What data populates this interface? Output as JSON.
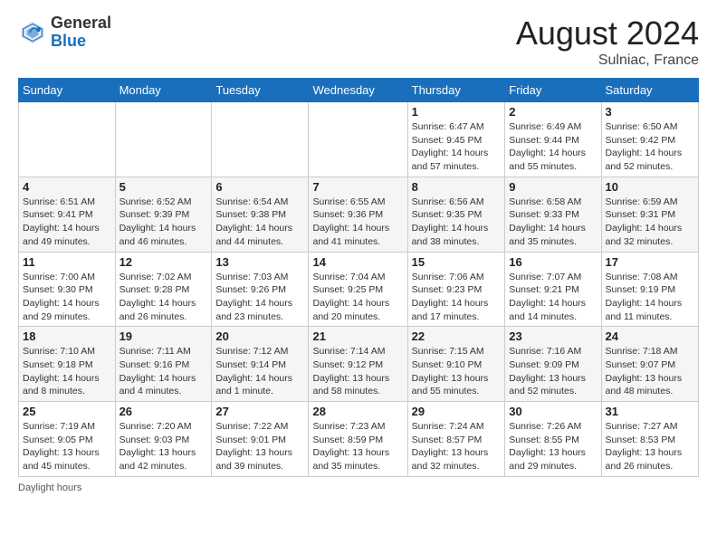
{
  "header": {
    "logo_general": "General",
    "logo_blue": "Blue",
    "month_year": "August 2024",
    "location": "Sulniac, France"
  },
  "days_of_week": [
    "Sunday",
    "Monday",
    "Tuesday",
    "Wednesday",
    "Thursday",
    "Friday",
    "Saturday"
  ],
  "weeks": [
    [
      {
        "day": "",
        "info": ""
      },
      {
        "day": "",
        "info": ""
      },
      {
        "day": "",
        "info": ""
      },
      {
        "day": "",
        "info": ""
      },
      {
        "day": "1",
        "info": "Sunrise: 6:47 AM\nSunset: 9:45 PM\nDaylight: 14 hours and 57 minutes."
      },
      {
        "day": "2",
        "info": "Sunrise: 6:49 AM\nSunset: 9:44 PM\nDaylight: 14 hours and 55 minutes."
      },
      {
        "day": "3",
        "info": "Sunrise: 6:50 AM\nSunset: 9:42 PM\nDaylight: 14 hours and 52 minutes."
      }
    ],
    [
      {
        "day": "4",
        "info": "Sunrise: 6:51 AM\nSunset: 9:41 PM\nDaylight: 14 hours and 49 minutes."
      },
      {
        "day": "5",
        "info": "Sunrise: 6:52 AM\nSunset: 9:39 PM\nDaylight: 14 hours and 46 minutes."
      },
      {
        "day": "6",
        "info": "Sunrise: 6:54 AM\nSunset: 9:38 PM\nDaylight: 14 hours and 44 minutes."
      },
      {
        "day": "7",
        "info": "Sunrise: 6:55 AM\nSunset: 9:36 PM\nDaylight: 14 hours and 41 minutes."
      },
      {
        "day": "8",
        "info": "Sunrise: 6:56 AM\nSunset: 9:35 PM\nDaylight: 14 hours and 38 minutes."
      },
      {
        "day": "9",
        "info": "Sunrise: 6:58 AM\nSunset: 9:33 PM\nDaylight: 14 hours and 35 minutes."
      },
      {
        "day": "10",
        "info": "Sunrise: 6:59 AM\nSunset: 9:31 PM\nDaylight: 14 hours and 32 minutes."
      }
    ],
    [
      {
        "day": "11",
        "info": "Sunrise: 7:00 AM\nSunset: 9:30 PM\nDaylight: 14 hours and 29 minutes."
      },
      {
        "day": "12",
        "info": "Sunrise: 7:02 AM\nSunset: 9:28 PM\nDaylight: 14 hours and 26 minutes."
      },
      {
        "day": "13",
        "info": "Sunrise: 7:03 AM\nSunset: 9:26 PM\nDaylight: 14 hours and 23 minutes."
      },
      {
        "day": "14",
        "info": "Sunrise: 7:04 AM\nSunset: 9:25 PM\nDaylight: 14 hours and 20 minutes."
      },
      {
        "day": "15",
        "info": "Sunrise: 7:06 AM\nSunset: 9:23 PM\nDaylight: 14 hours and 17 minutes."
      },
      {
        "day": "16",
        "info": "Sunrise: 7:07 AM\nSunset: 9:21 PM\nDaylight: 14 hours and 14 minutes."
      },
      {
        "day": "17",
        "info": "Sunrise: 7:08 AM\nSunset: 9:19 PM\nDaylight: 14 hours and 11 minutes."
      }
    ],
    [
      {
        "day": "18",
        "info": "Sunrise: 7:10 AM\nSunset: 9:18 PM\nDaylight: 14 hours and 8 minutes."
      },
      {
        "day": "19",
        "info": "Sunrise: 7:11 AM\nSunset: 9:16 PM\nDaylight: 14 hours and 4 minutes."
      },
      {
        "day": "20",
        "info": "Sunrise: 7:12 AM\nSunset: 9:14 PM\nDaylight: 14 hours and 1 minute."
      },
      {
        "day": "21",
        "info": "Sunrise: 7:14 AM\nSunset: 9:12 PM\nDaylight: 13 hours and 58 minutes."
      },
      {
        "day": "22",
        "info": "Sunrise: 7:15 AM\nSunset: 9:10 PM\nDaylight: 13 hours and 55 minutes."
      },
      {
        "day": "23",
        "info": "Sunrise: 7:16 AM\nSunset: 9:09 PM\nDaylight: 13 hours and 52 minutes."
      },
      {
        "day": "24",
        "info": "Sunrise: 7:18 AM\nSunset: 9:07 PM\nDaylight: 13 hours and 48 minutes."
      }
    ],
    [
      {
        "day": "25",
        "info": "Sunrise: 7:19 AM\nSunset: 9:05 PM\nDaylight: 13 hours and 45 minutes."
      },
      {
        "day": "26",
        "info": "Sunrise: 7:20 AM\nSunset: 9:03 PM\nDaylight: 13 hours and 42 minutes."
      },
      {
        "day": "27",
        "info": "Sunrise: 7:22 AM\nSunset: 9:01 PM\nDaylight: 13 hours and 39 minutes."
      },
      {
        "day": "28",
        "info": "Sunrise: 7:23 AM\nSunset: 8:59 PM\nDaylight: 13 hours and 35 minutes."
      },
      {
        "day": "29",
        "info": "Sunrise: 7:24 AM\nSunset: 8:57 PM\nDaylight: 13 hours and 32 minutes."
      },
      {
        "day": "30",
        "info": "Sunrise: 7:26 AM\nSunset: 8:55 PM\nDaylight: 13 hours and 29 minutes."
      },
      {
        "day": "31",
        "info": "Sunrise: 7:27 AM\nSunset: 8:53 PM\nDaylight: 13 hours and 26 minutes."
      }
    ]
  ],
  "footer": {
    "daylight_hours": "Daylight hours"
  }
}
